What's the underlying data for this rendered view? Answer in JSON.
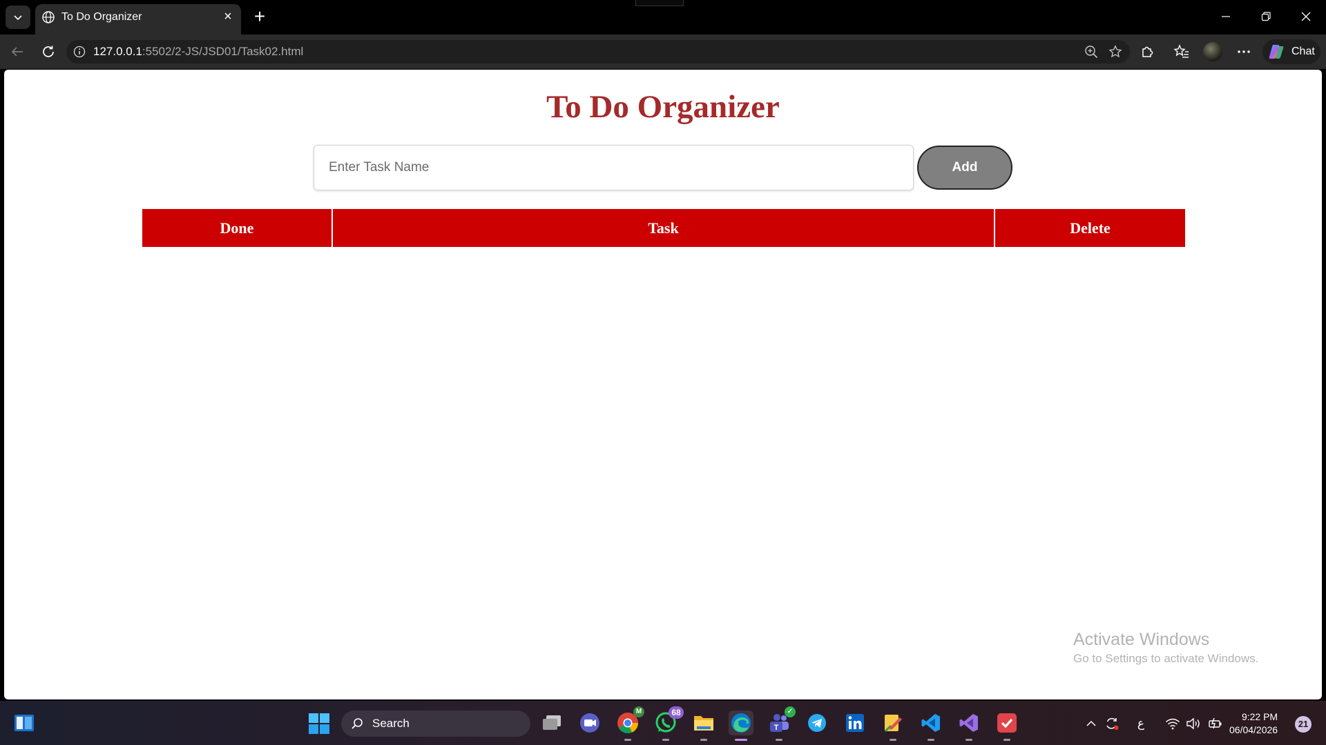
{
  "browser": {
    "tab": {
      "title": "To Do Organizer"
    },
    "address": {
      "host": "127.0.0.1",
      "rest": ":5502/2-JS/JSD01/Task02.html"
    },
    "chat_label": "Chat"
  },
  "page": {
    "title": "To Do Organizer",
    "input": {
      "placeholder": "Enter Task Name",
      "value": ""
    },
    "add_label": "Add",
    "table": {
      "headers": [
        "Done",
        "Task",
        "Delete"
      ],
      "rows": []
    },
    "header_color": "#cc0000",
    "title_color": "#a52a2a"
  },
  "watermark": {
    "title": "Activate Windows",
    "subtitle": "Go to Settings to activate Windows."
  },
  "taskbar": {
    "search_label": "Search",
    "whatsapp_badge": "68",
    "chrome_badge": "M",
    "tray_lang": "ع",
    "time": "9:22 PM",
    "date": "06/04/2026",
    "notification_count": "21"
  }
}
